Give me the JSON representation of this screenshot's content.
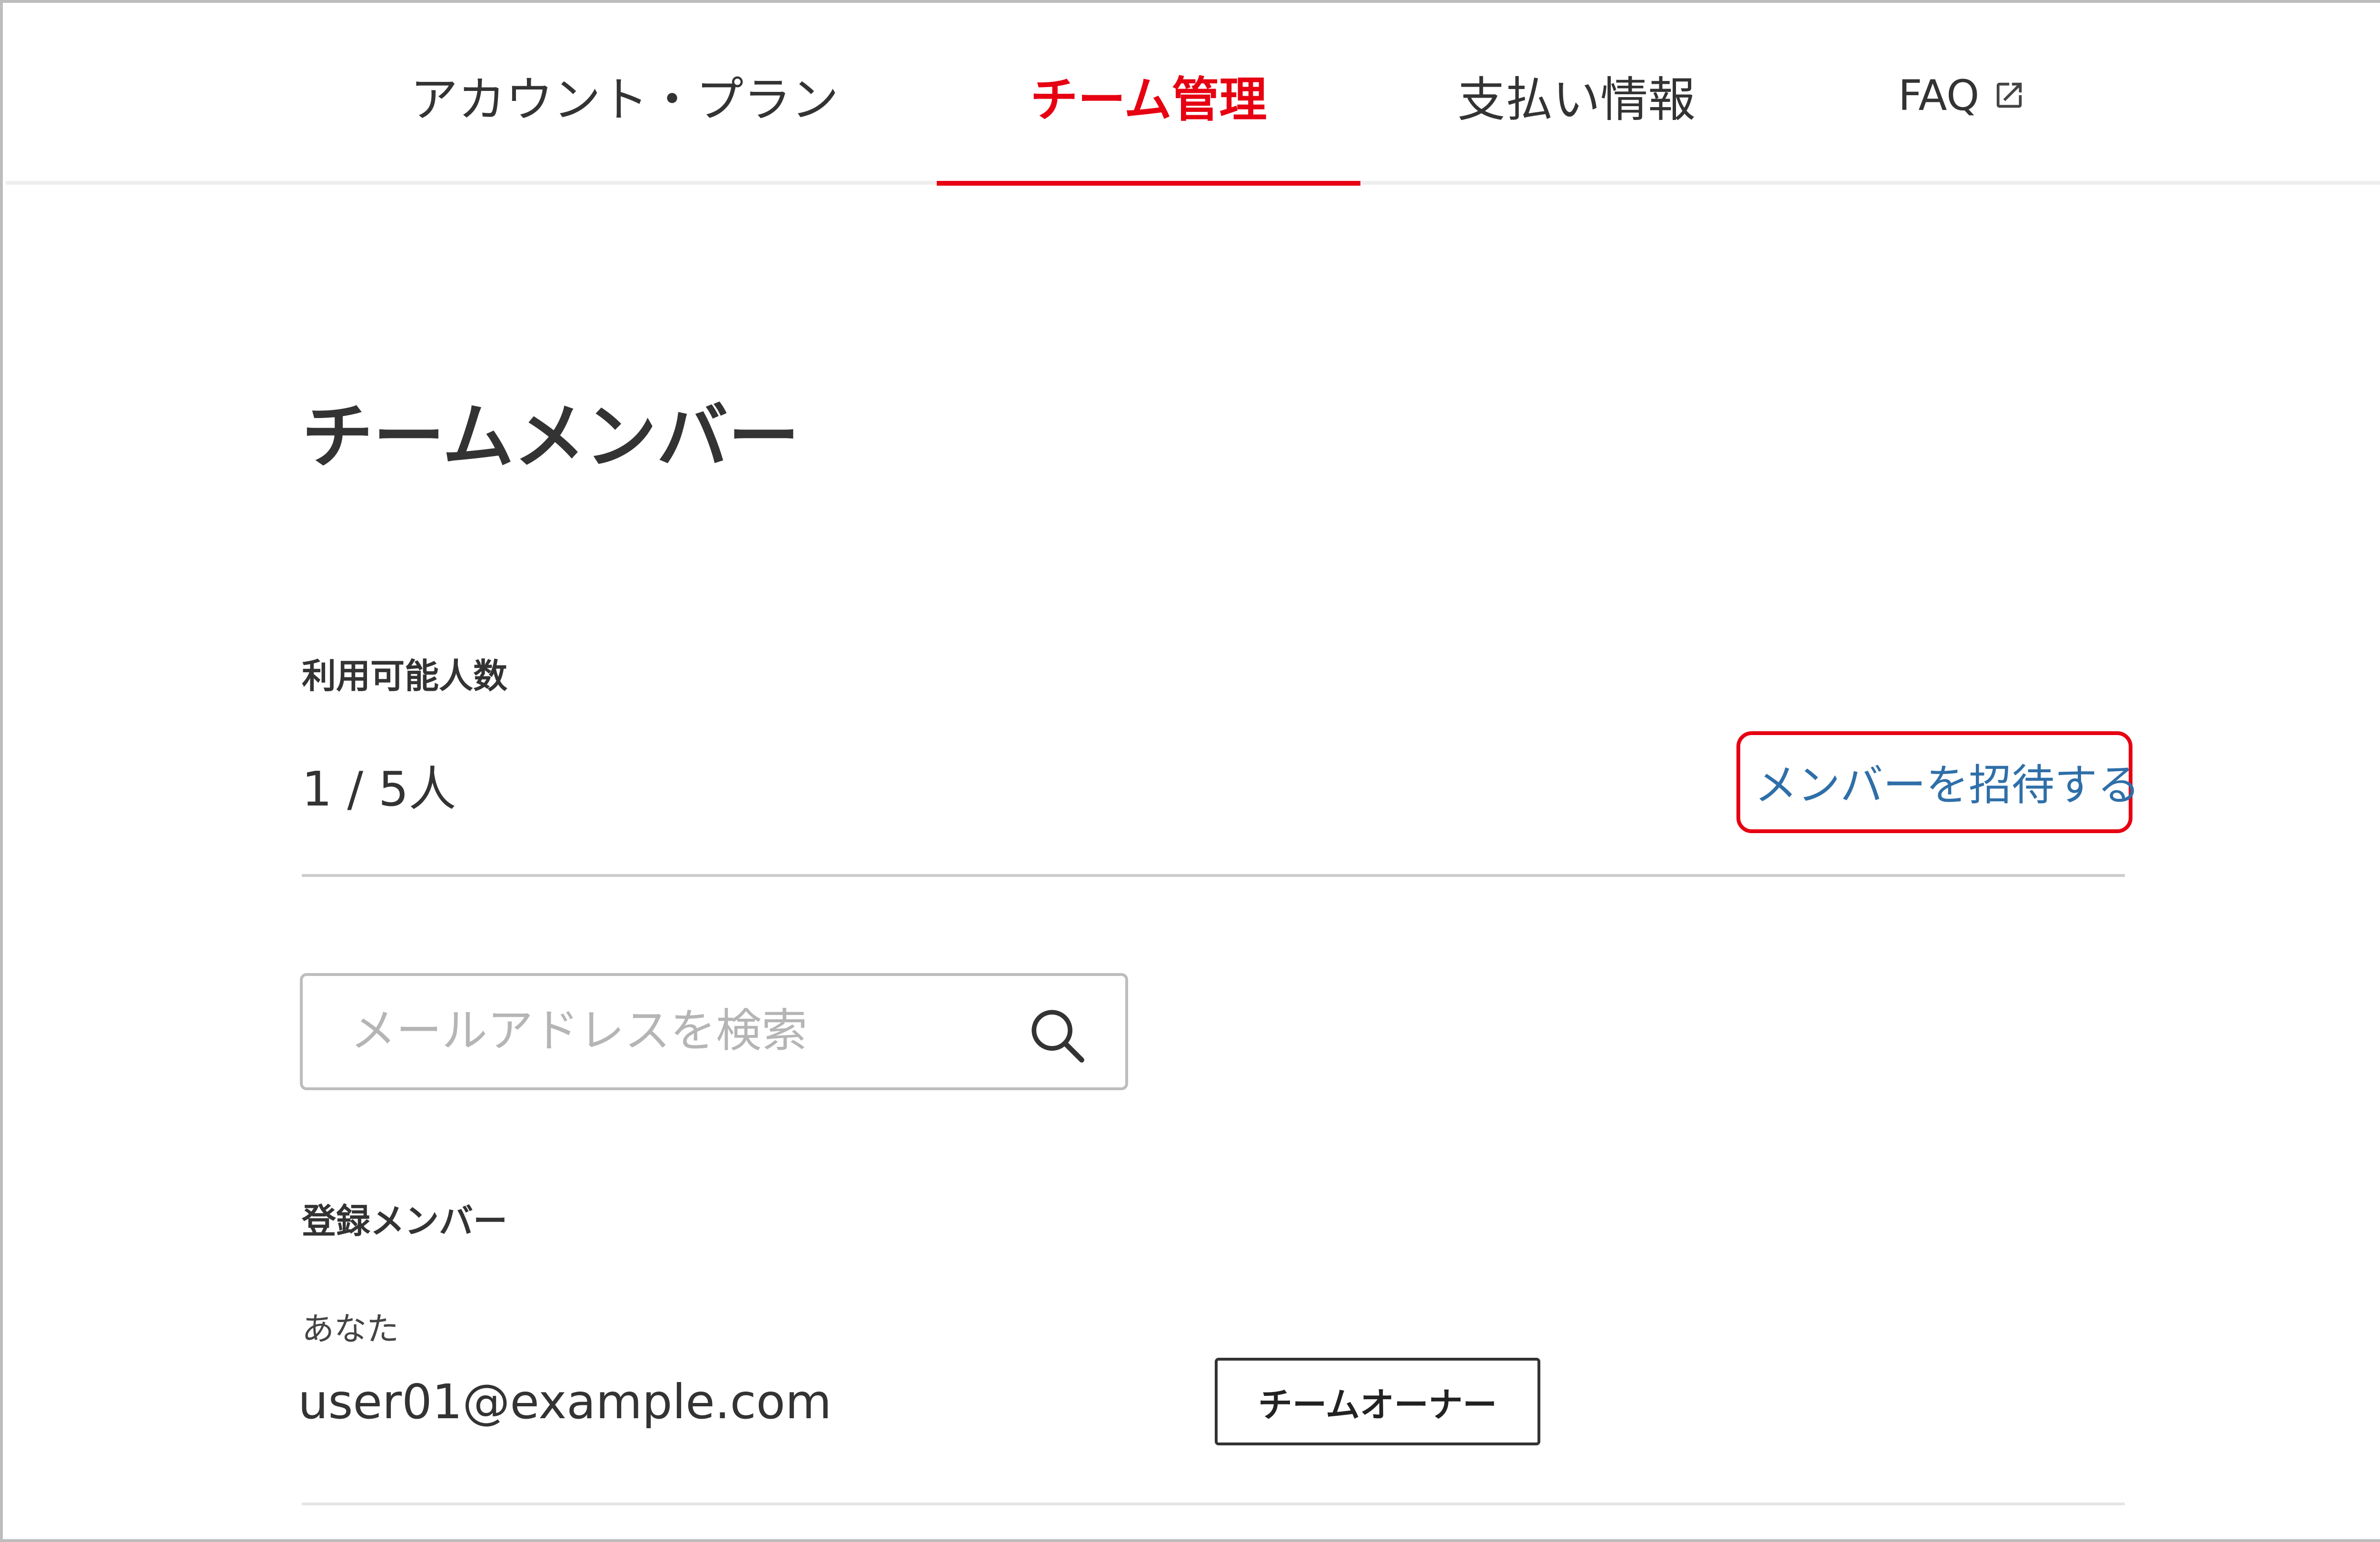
{
  "nav": {
    "tabs": [
      {
        "label": "アカウント・プラン",
        "active": false
      },
      {
        "label": "チーム管理",
        "active": true
      },
      {
        "label": "支払い情報",
        "active": false
      },
      {
        "label": "FAQ",
        "active": false,
        "icon": "external-link-icon"
      }
    ]
  },
  "page": {
    "title": "チームメンバー"
  },
  "capacity": {
    "label": "利用可能人数",
    "value": "1 / 5人"
  },
  "invite": {
    "label": "メンバーを招待する"
  },
  "search": {
    "placeholder": "メールアドレスを検索",
    "value": "",
    "icon": "search-icon"
  },
  "members": {
    "heading": "登録メンバー",
    "items": [
      {
        "tag": "あなた",
        "email": "user01@example.com",
        "role": "チームオーナー"
      }
    ]
  },
  "colors": {
    "accent": "#e60012",
    "link": "#2f6fa8",
    "text": "#333333",
    "divider": "#cccccc"
  }
}
